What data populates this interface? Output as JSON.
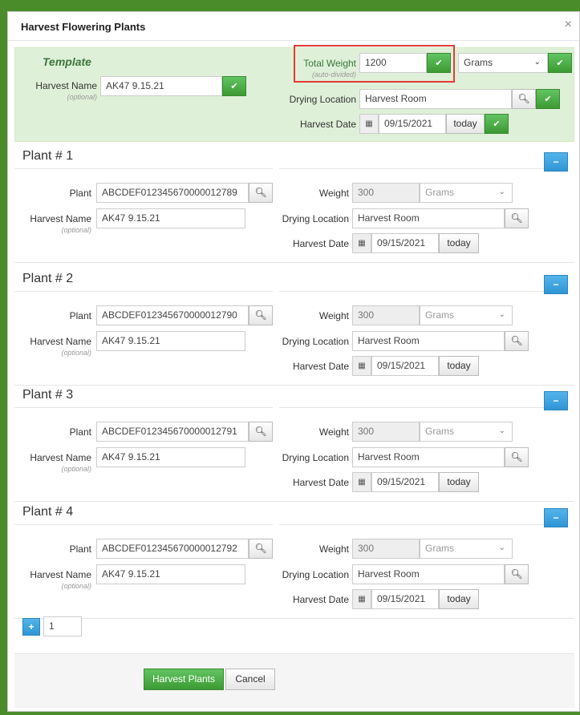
{
  "modal": {
    "title": "Harvest Flowering Plants",
    "close": "×"
  },
  "template": {
    "title": "Template",
    "harvest_name_label": "Harvest Name",
    "optional": "(optional)",
    "harvest_name_value": "AK47 9.15.21",
    "total_weight_label": "Total Weight",
    "total_weight_sub": "(auto-divided)",
    "total_weight_value": "1200",
    "unit_value": "Grams",
    "drying_label": "Drying Location",
    "drying_value": "Harvest Room",
    "date_label": "Harvest Date",
    "date_value": "09/15/2021",
    "today": "today"
  },
  "plants": [
    {
      "title": "Plant # 1",
      "plant_label": "Plant",
      "plant_value": "ABCDEF012345670000012789",
      "harvest_name_label": "Harvest Name",
      "optional": "(optional)",
      "harvest_name_value": "AK47 9.15.21",
      "weight_label": "Weight",
      "weight_value": "300",
      "unit_value": "Grams",
      "drying_label": "Drying Location",
      "drying_value": "Harvest Room",
      "date_label": "Harvest Date",
      "date_value": "09/15/2021",
      "today": "today"
    },
    {
      "title": "Plant # 2",
      "plant_label": "Plant",
      "plant_value": "ABCDEF012345670000012790",
      "harvest_name_label": "Harvest Name",
      "optional": "(optional)",
      "harvest_name_value": "AK47 9.15.21",
      "weight_label": "Weight",
      "weight_value": "300",
      "unit_value": "Grams",
      "drying_label": "Drying Location",
      "drying_value": "Harvest Room",
      "date_label": "Harvest Date",
      "date_value": "09/15/2021",
      "today": "today"
    },
    {
      "title": "Plant # 3",
      "plant_label": "Plant",
      "plant_value": "ABCDEF012345670000012791",
      "harvest_name_label": "Harvest Name",
      "optional": "(optional)",
      "harvest_name_value": "AK47 9.15.21",
      "weight_label": "Weight",
      "weight_value": "300",
      "unit_value": "Grams",
      "drying_label": "Drying Location",
      "drying_value": "Harvest Room",
      "date_label": "Harvest Date",
      "date_value": "09/15/2021",
      "today": "today"
    },
    {
      "title": "Plant # 4",
      "plant_label": "Plant",
      "plant_value": "ABCDEF012345670000012792",
      "harvest_name_label": "Harvest Name",
      "optional": "(optional)",
      "harvest_name_value": "AK47 9.15.21",
      "weight_label": "Weight",
      "weight_value": "300",
      "unit_value": "Grams",
      "drying_label": "Drying Location",
      "drying_value": "Harvest Room",
      "date_label": "Harvest Date",
      "date_value": "09/15/2021",
      "today": "today"
    }
  ],
  "add_row": {
    "count_value": "1"
  },
  "footer": {
    "harvest_button": "Harvest Plants",
    "cancel_button": "Cancel"
  },
  "icons": {
    "check": "check-icon",
    "search": "search-icon",
    "calendar": "calendar-icon",
    "minus": "minus-icon",
    "plus": "plus-icon",
    "caret": "chevron-down-icon"
  },
  "colors": {
    "primary_green": "#3c9a32",
    "template_bg": "#dff0d8",
    "accent_blue": "#2f96d4",
    "highlight_red": "#e53935"
  }
}
